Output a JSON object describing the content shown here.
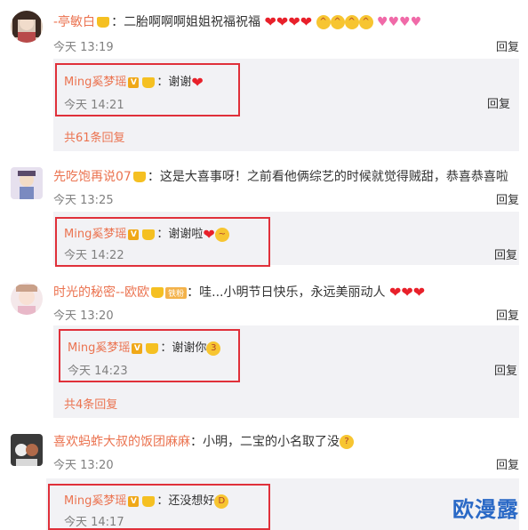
{
  "comments": [
    {
      "username": "-亭敏白",
      "text": "二胎啊啊啊姐姐祝福祝福",
      "time": "今天 13:19",
      "reply_label": "回复",
      "reply": {
        "username": "Ming奚梦瑶",
        "text": "谢谢",
        "time": "今天 14:21",
        "reply_label": "回复"
      },
      "more": "共61条回复"
    },
    {
      "username": "先吃饱再说07",
      "text": "这是大喜事呀！之前看他俩综艺的时候就觉得贼甜，恭喜恭喜啦",
      "time": "今天 13:25",
      "reply_label": "回复",
      "reply": {
        "username": "Ming奚梦瑶",
        "text": "谢谢啦",
        "time": "今天 14:22",
        "reply_label": "回复"
      }
    },
    {
      "username": "时光的秘密--欧欧",
      "badge": "铁粉",
      "text": "哇...小明节日快乐，永远美丽动人",
      "time": "今天 13:20",
      "reply_label": "回复",
      "reply": {
        "username": "Ming奚梦瑶",
        "text": "谢谢你",
        "time": "今天 14:23",
        "reply_label": "回复"
      },
      "more": "共4条回复"
    },
    {
      "username": "喜欢蚂蚱大叔的饭团麻麻",
      "text": "小明，二宝的小名取了没",
      "time": "今天 13:20",
      "reply_label": "回复",
      "reply": {
        "username": "Ming奚梦瑶",
        "text": "还没想好",
        "time": "今天 14:17"
      }
    }
  ],
  "watermark": "欧漫露",
  "colors": {
    "username": "#eb7350",
    "highlight_border": "#e0303a",
    "reply_bg": "#f2f2f5",
    "watermark": "#2a69c6"
  }
}
